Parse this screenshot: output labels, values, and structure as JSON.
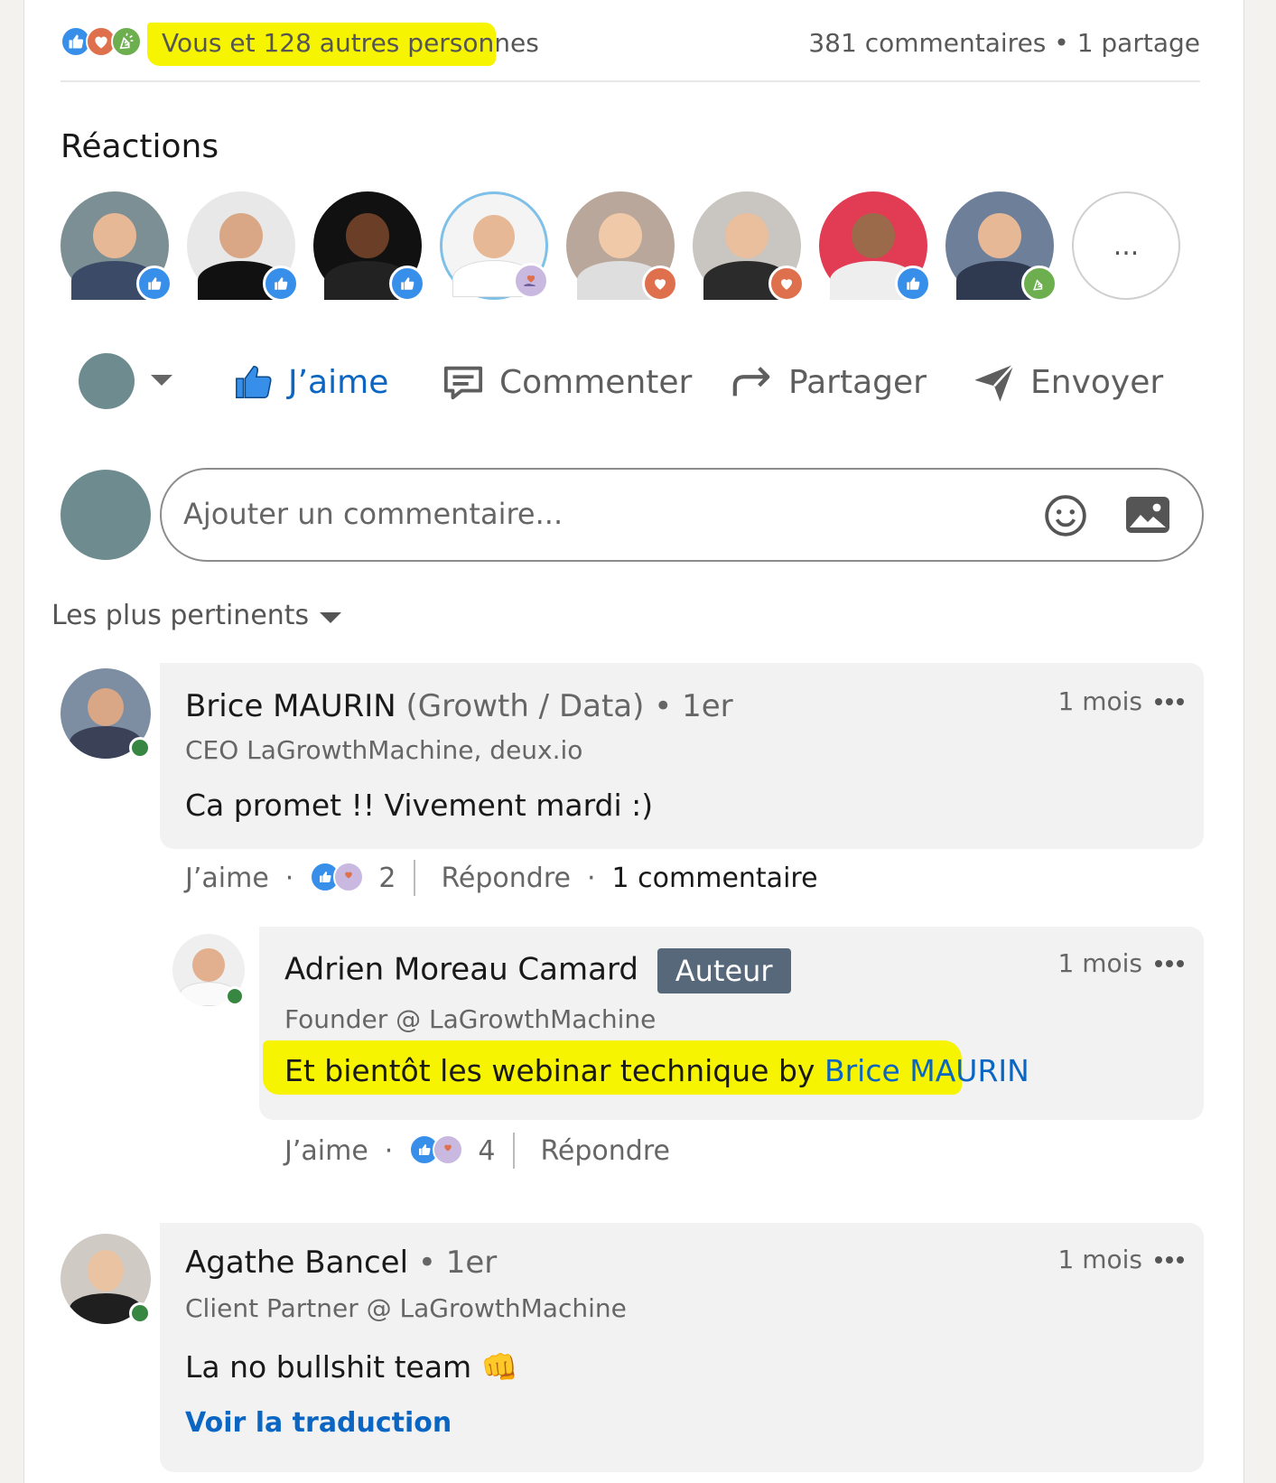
{
  "summary": {
    "likes_text": "Vous et 128 autres personnes",
    "stats_text": "381 commentaires • 1 partage"
  },
  "reactions": {
    "title": "Réactions",
    "more_label": "..."
  },
  "actions": {
    "like": "J’aime",
    "comment": "Commenter",
    "share": "Partager",
    "send": "Envoyer"
  },
  "comment_box": {
    "placeholder": "Ajouter un commentaire..."
  },
  "sort": {
    "label": "Les plus pertinents"
  },
  "comments": [
    {
      "name": "Brice MAURIN",
      "role": "(Growth / Data)",
      "degree": "• 1er",
      "headline": "CEO LaGrowthMachine, deux.io",
      "time": "1 mois",
      "text": "Ca promet !! Vivement mardi :)",
      "like_label": "J’aime",
      "reactions_count": "2",
      "reply_label": "Répondre",
      "replies_label": "1 commentaire"
    },
    {
      "name": "Adrien Moreau Camard",
      "badge": "Auteur",
      "headline": "Founder @ LaGrowthMachine",
      "time": "1 mois",
      "text_prefix": "Et bientôt les webinar technique by ",
      "mention": "Brice MAURIN",
      "like_label": "J’aime",
      "reactions_count": "4",
      "reply_label": "Répondre"
    },
    {
      "name": "Agathe Bancel",
      "degree": "• 1er",
      "headline": "Client Partner @ LaGrowthMachine",
      "time": "1 mois",
      "text": "La no bullshit team 👊",
      "translate_label": "Voir la traduction"
    }
  ],
  "colors": {
    "like_blue": "#378fe9",
    "love_orange": "#df704d",
    "support_purple": "#c9b8e0",
    "celebrate_green": "#6dae4f",
    "highlight_yellow": "#f6f400",
    "link_blue": "#0a66c2"
  }
}
